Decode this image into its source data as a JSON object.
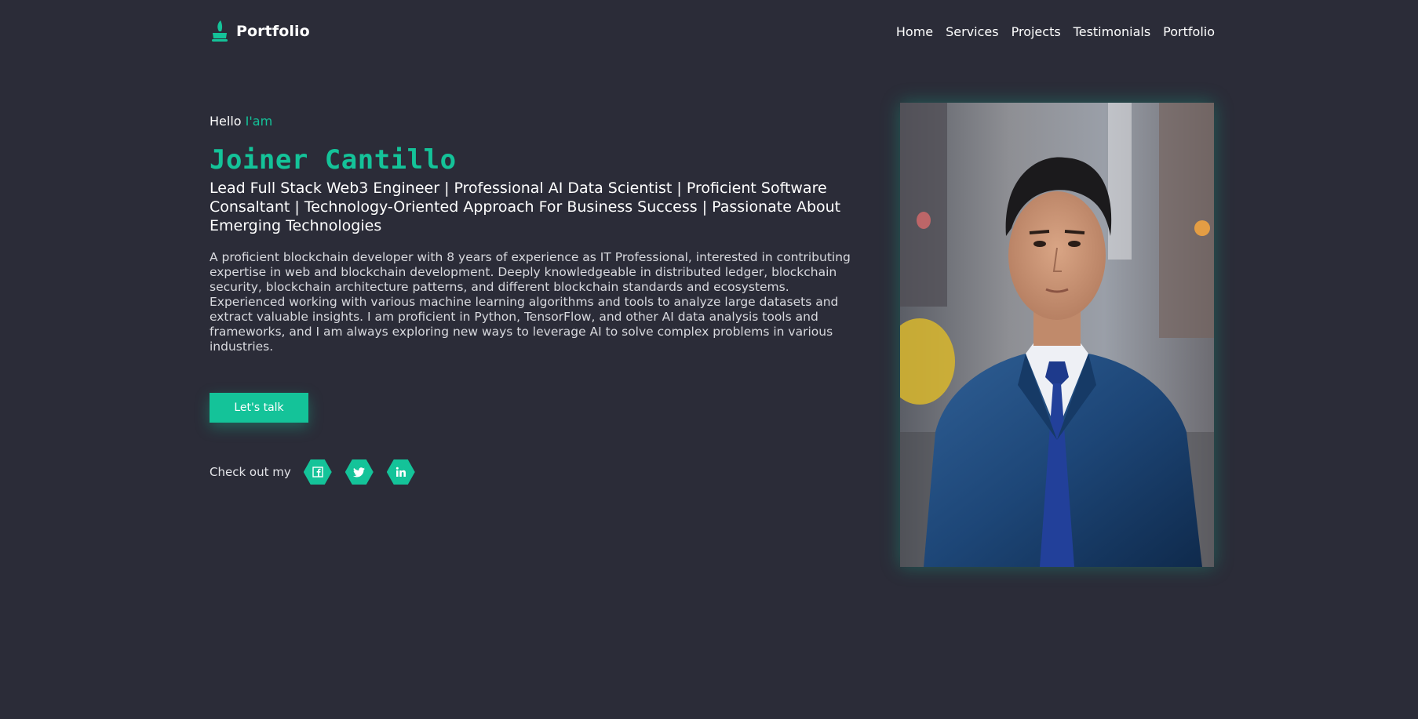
{
  "header": {
    "logo_text": "Portfolio",
    "logo_icon": "quill-pot-icon",
    "nav": [
      {
        "label": "Home"
      },
      {
        "label": "Services"
      },
      {
        "label": "Projects"
      },
      {
        "label": "Testimonials"
      },
      {
        "label": "Portfolio"
      }
    ]
  },
  "hero": {
    "greeting": "Hello",
    "greeting_accent": "I'am",
    "name": "Joiner Cantillo",
    "tagline": "Lead Full Stack Web3 Engineer | Professional AI Data Scientist | Proficient Software Consaltant | Technology-Oriented Approach For Business Success | Passionate About Emerging Technologies",
    "bio": "A proficient blockchain developer with 8 years of experience as IT Professional, interested in contributing expertise in web and blockchain development. Deeply knowledgeable in distributed ledger, blockchain security, blockchain architecture patterns, and different blockchain standards and ecosystems. Experienced working with various machine learning algorithms and tools to analyze large datasets and extract valuable insights. I am proficient in Python, TensorFlow, and other AI data analysis tools and frameworks, and I am always exploring new ways to leverage AI to solve complex problems in various industries.",
    "cta_label": "Let's talk",
    "social_label": "Check out my",
    "social": [
      {
        "icon": "facebook-icon"
      },
      {
        "icon": "twitter-icon"
      },
      {
        "icon": "linkedin-icon"
      }
    ]
  },
  "colors": {
    "background": "#2b2c38",
    "accent": "#14c399",
    "text": "#ffffff"
  }
}
